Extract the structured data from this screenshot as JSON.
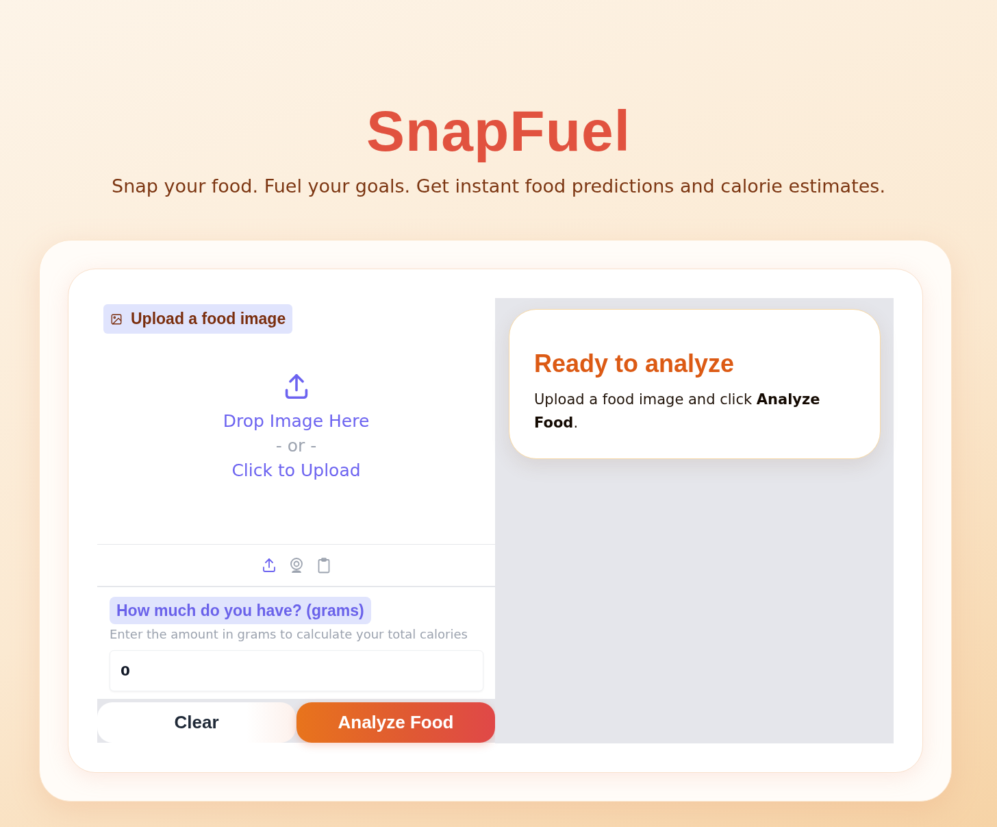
{
  "header": {
    "title": "SnapFuel",
    "subtitle": "Snap your food. Fuel your goals. Get instant food predictions and calorie estimates."
  },
  "upload": {
    "label": "Upload a food image",
    "drop_text": "Drop Image Here",
    "separator": "- or -",
    "click_text": "Click to Upload",
    "sources": [
      {
        "kind": "upload",
        "selected": true
      },
      {
        "kind": "webcam",
        "selected": false
      },
      {
        "kind": "clipboard",
        "selected": false
      }
    ]
  },
  "amount": {
    "label": "How much do you have? (grams)",
    "hint": "Enter the amount in grams to calculate your total calories",
    "value": "0"
  },
  "buttons": [
    {
      "kind": "secondary",
      "label": "Clear"
    },
    {
      "kind": "primary",
      "label": "Analyze Food"
    }
  ],
  "result": {
    "title": "Ready to analyze",
    "message": "Upload a food image and click **Analyze Food**."
  }
}
